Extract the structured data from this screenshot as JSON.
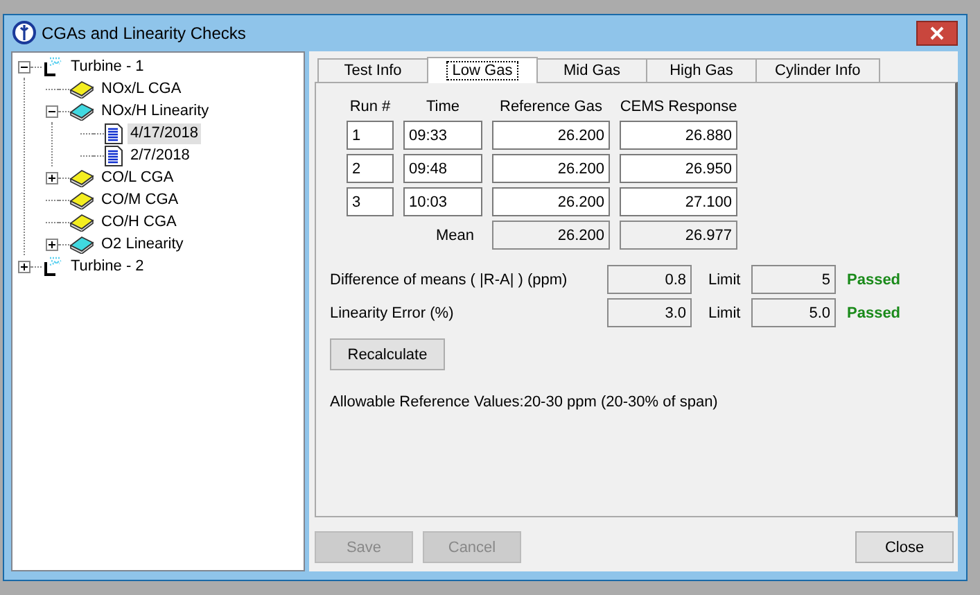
{
  "window": {
    "title": "CGAs and Linearity Checks"
  },
  "tree": [
    {
      "label": "Turbine - 1",
      "kind": "turbine",
      "expanded": true,
      "selected": false,
      "children": [
        {
          "label": "NOx/L CGA",
          "kind": "cga",
          "selected": false
        },
        {
          "label": "NOx/H Linearity",
          "kind": "linearity",
          "expanded": true,
          "selected": false,
          "children": [
            {
              "label": "4/17/2018",
              "kind": "record",
              "selected": true
            },
            {
              "label": "2/7/2018",
              "kind": "record",
              "selected": false
            }
          ]
        },
        {
          "label": "CO/L CGA",
          "kind": "cga",
          "expanded": false,
          "selected": false
        },
        {
          "label": "CO/M CGA",
          "kind": "cga",
          "selected": false
        },
        {
          "label": "CO/H CGA",
          "kind": "cga",
          "selected": false
        },
        {
          "label": "O2 Linearity",
          "kind": "linearity",
          "expanded": false,
          "selected": false
        }
      ]
    },
    {
      "label": "Turbine - 2",
      "kind": "turbine",
      "expanded": false,
      "selected": false
    }
  ],
  "tabs": [
    {
      "label": "Test Info",
      "selected": false
    },
    {
      "label": "Low Gas",
      "selected": true
    },
    {
      "label": "Mid Gas",
      "selected": false
    },
    {
      "label": "High Gas",
      "selected": false
    },
    {
      "label": "Cylinder Info",
      "selected": false
    }
  ],
  "runs": {
    "columns": [
      "Run #",
      "Time",
      "Reference Gas",
      "CEMS Response"
    ],
    "rows": [
      {
        "run": "1",
        "time": "09:33",
        "reference": "26.200",
        "response": "26.880"
      },
      {
        "run": "2",
        "time": "09:48",
        "reference": "26.200",
        "response": "26.950"
      },
      {
        "run": "3",
        "time": "10:03",
        "reference": "26.200",
        "response": "27.100"
      }
    ],
    "mean": {
      "label": "Mean",
      "reference": "26.200",
      "response": "26.977"
    }
  },
  "checks": [
    {
      "label": "Difference of means ( |R-A| ) (ppm)",
      "value": "0.8",
      "limit_label": "Limit",
      "limit": "5",
      "status": "Passed",
      "passed": true
    },
    {
      "label": "Linearity Error (%)",
      "value": "3.0",
      "limit_label": "Limit",
      "limit": "5.0",
      "status": "Passed",
      "passed": true
    }
  ],
  "recalculate_button": "Recalculate",
  "note": "Allowable Reference Values:20-30 ppm (20-30% of span)",
  "buttons": [
    {
      "label": "Save",
      "disabled": true
    },
    {
      "label": "Cancel",
      "disabled": true
    },
    {
      "label": "Close",
      "disabled": false
    }
  ]
}
